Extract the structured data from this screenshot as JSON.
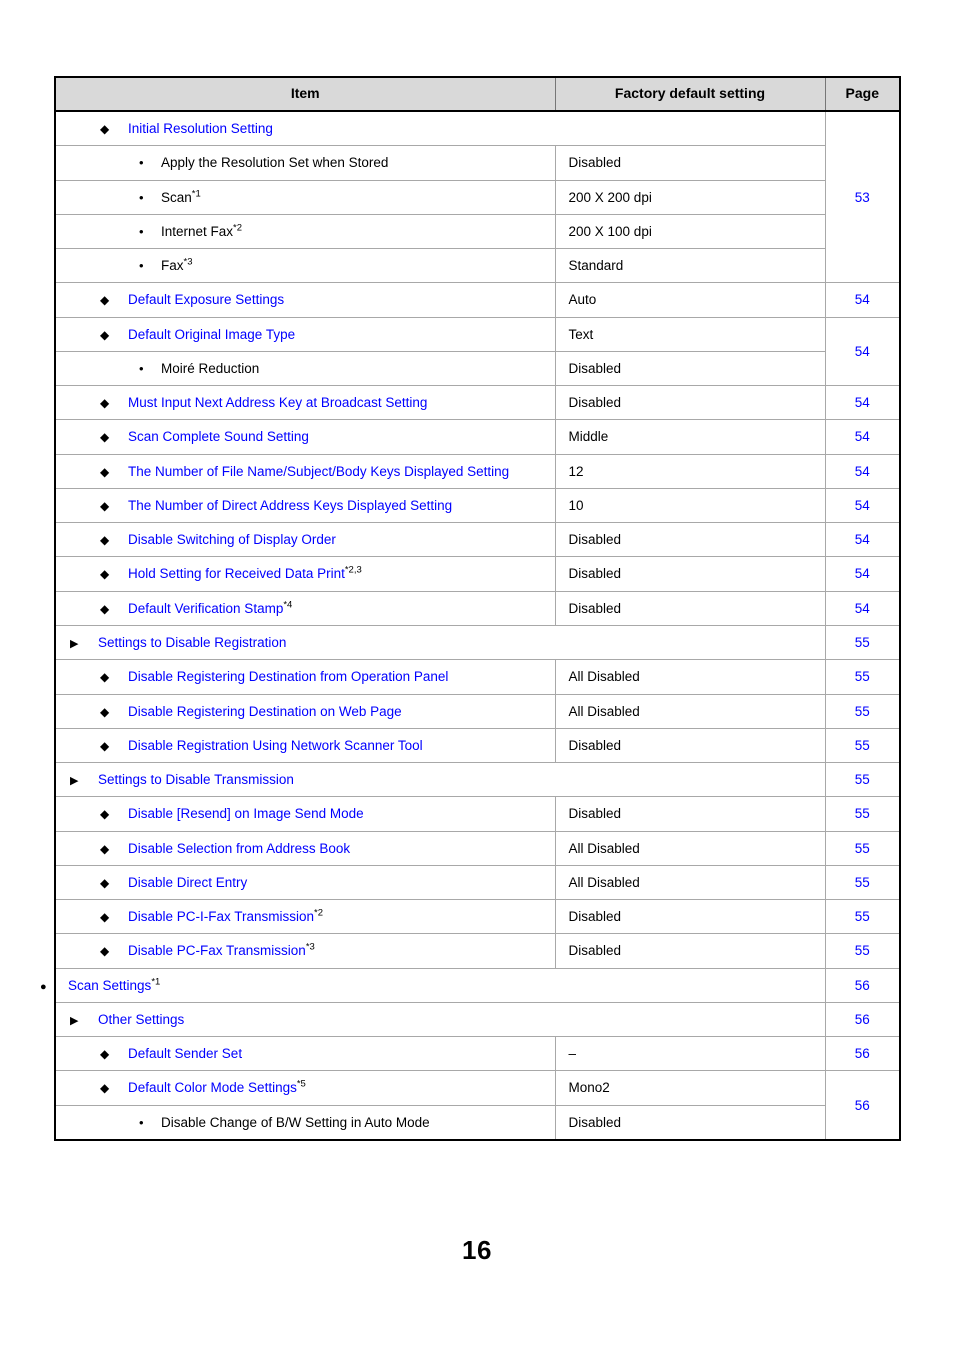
{
  "document": {
    "page_number": "16"
  },
  "table": {
    "headers": {
      "item": "Item",
      "factory_default": "Factory default setting",
      "page": "Page"
    },
    "markers": {
      "circle": "●",
      "triangle": "▶",
      "diamond": "◆",
      "bullet": "•"
    },
    "colors": {
      "link": "#0000ff",
      "header_background": "#d9d9d9",
      "border": "#000000"
    },
    "rows": [
      {
        "label": "Initial Resolution Setting",
        "sup": "",
        "level": 2,
        "marker": "diamond",
        "value": null,
        "page": "53",
        "span_item": true
      },
      {
        "label": "Apply the Resolution Set when Stored",
        "sup": "",
        "level": 3,
        "marker": "bullet",
        "value": "Disabled",
        "page": null
      },
      {
        "label": "Scan",
        "sup": "*1",
        "level": 3,
        "marker": "bullet",
        "value": "200 X 200 dpi",
        "page": null
      },
      {
        "label": "Internet Fax",
        "sup": "*2",
        "level": 3,
        "marker": "bullet",
        "value": "200 X 100 dpi",
        "page": null
      },
      {
        "label": "Fax",
        "sup": "*3",
        "level": 3,
        "marker": "bullet",
        "value": "Standard",
        "page": null
      },
      {
        "label": "Default Exposure Settings",
        "sup": "",
        "level": 2,
        "marker": "diamond",
        "value": "Auto",
        "page": "54"
      },
      {
        "label": "Default Original Image Type",
        "sup": "",
        "level": 2,
        "marker": "diamond",
        "value": "Text",
        "page": "54"
      },
      {
        "label": "Moiré Reduction",
        "sup": "",
        "level": 3,
        "marker": "bullet",
        "value": "Disabled",
        "page": null
      },
      {
        "label": "Must Input Next Address Key at Broadcast Setting",
        "sup": "",
        "level": 2,
        "marker": "diamond",
        "value": "Disabled",
        "page": "54"
      },
      {
        "label": "Scan Complete Sound Setting",
        "sup": "",
        "level": 2,
        "marker": "diamond",
        "value": "Middle",
        "page": "54"
      },
      {
        "label": "The Number of File Name/Subject/Body Keys Displayed Setting",
        "sup": "",
        "level": 2,
        "marker": "diamond",
        "value": "12",
        "page": "54"
      },
      {
        "label": "The Number of Direct Address Keys Displayed Setting",
        "sup": "",
        "level": 2,
        "marker": "diamond",
        "value": "10",
        "page": "54"
      },
      {
        "label": "Disable Switching of Display Order",
        "sup": "",
        "level": 2,
        "marker": "diamond",
        "value": "Disabled",
        "page": "54"
      },
      {
        "label": "Hold Setting for Received Data Print",
        "sup": "*2,3",
        "level": 2,
        "marker": "diamond",
        "value": "Disabled",
        "page": "54"
      },
      {
        "label": "Default Verification Stamp",
        "sup": "*4",
        "level": 2,
        "marker": "diamond",
        "value": "Disabled",
        "page": "54"
      },
      {
        "label": "Settings to Disable Registration",
        "sup": "",
        "level": 1,
        "marker": "triangle",
        "value": null,
        "page": "55",
        "span_item": true
      },
      {
        "label": "Disable Registering Destination from Operation Panel",
        "sup": "",
        "level": 2,
        "marker": "diamond",
        "value": "All Disabled",
        "page": "55"
      },
      {
        "label": "Disable Registering Destination on Web Page",
        "sup": "",
        "level": 2,
        "marker": "diamond",
        "value": "All Disabled",
        "page": "55"
      },
      {
        "label": "Disable Registration Using Network Scanner Tool",
        "sup": "",
        "level": 2,
        "marker": "diamond",
        "value": "Disabled",
        "page": "55"
      },
      {
        "label": "Settings to Disable Transmission",
        "sup": "",
        "level": 1,
        "marker": "triangle",
        "value": null,
        "page": "55",
        "span_item": true
      },
      {
        "label": "Disable [Resend] on Image Send Mode",
        "sup": "",
        "level": 2,
        "marker": "diamond",
        "value": "Disabled",
        "page": "55"
      },
      {
        "label": "Disable Selection from Address Book",
        "sup": "",
        "level": 2,
        "marker": "diamond",
        "value": "All Disabled",
        "page": "55"
      },
      {
        "label": "Disable Direct Entry",
        "sup": "",
        "level": 2,
        "marker": "diamond",
        "value": "All Disabled",
        "page": "55"
      },
      {
        "label": "Disable PC-I-Fax Transmission",
        "sup": "*2",
        "level": 2,
        "marker": "diamond",
        "value": "Disabled",
        "page": "55"
      },
      {
        "label": "Disable PC-Fax Transmission",
        "sup": "*3",
        "level": 2,
        "marker": "diamond",
        "value": "Disabled",
        "page": "55"
      },
      {
        "label": "Scan Settings",
        "sup": "*1",
        "level": 0,
        "marker": "circle",
        "value": null,
        "page": "56",
        "span_item": true
      },
      {
        "label": "Other Settings",
        "sup": "",
        "level": 1,
        "marker": "triangle",
        "value": null,
        "page": "56",
        "span_item": true
      },
      {
        "label": "Default Sender Set",
        "sup": "",
        "level": 2,
        "marker": "diamond",
        "value": "–",
        "page": "56"
      },
      {
        "label": "Default Color Mode Settings",
        "sup": "*5",
        "level": 2,
        "marker": "diamond",
        "value": "Mono2",
        "page": "56"
      },
      {
        "label": "Disable Change of B/W Setting in Auto Mode",
        "sup": "",
        "level": 3,
        "marker": "bullet",
        "value": "Disabled",
        "page": null
      }
    ]
  }
}
